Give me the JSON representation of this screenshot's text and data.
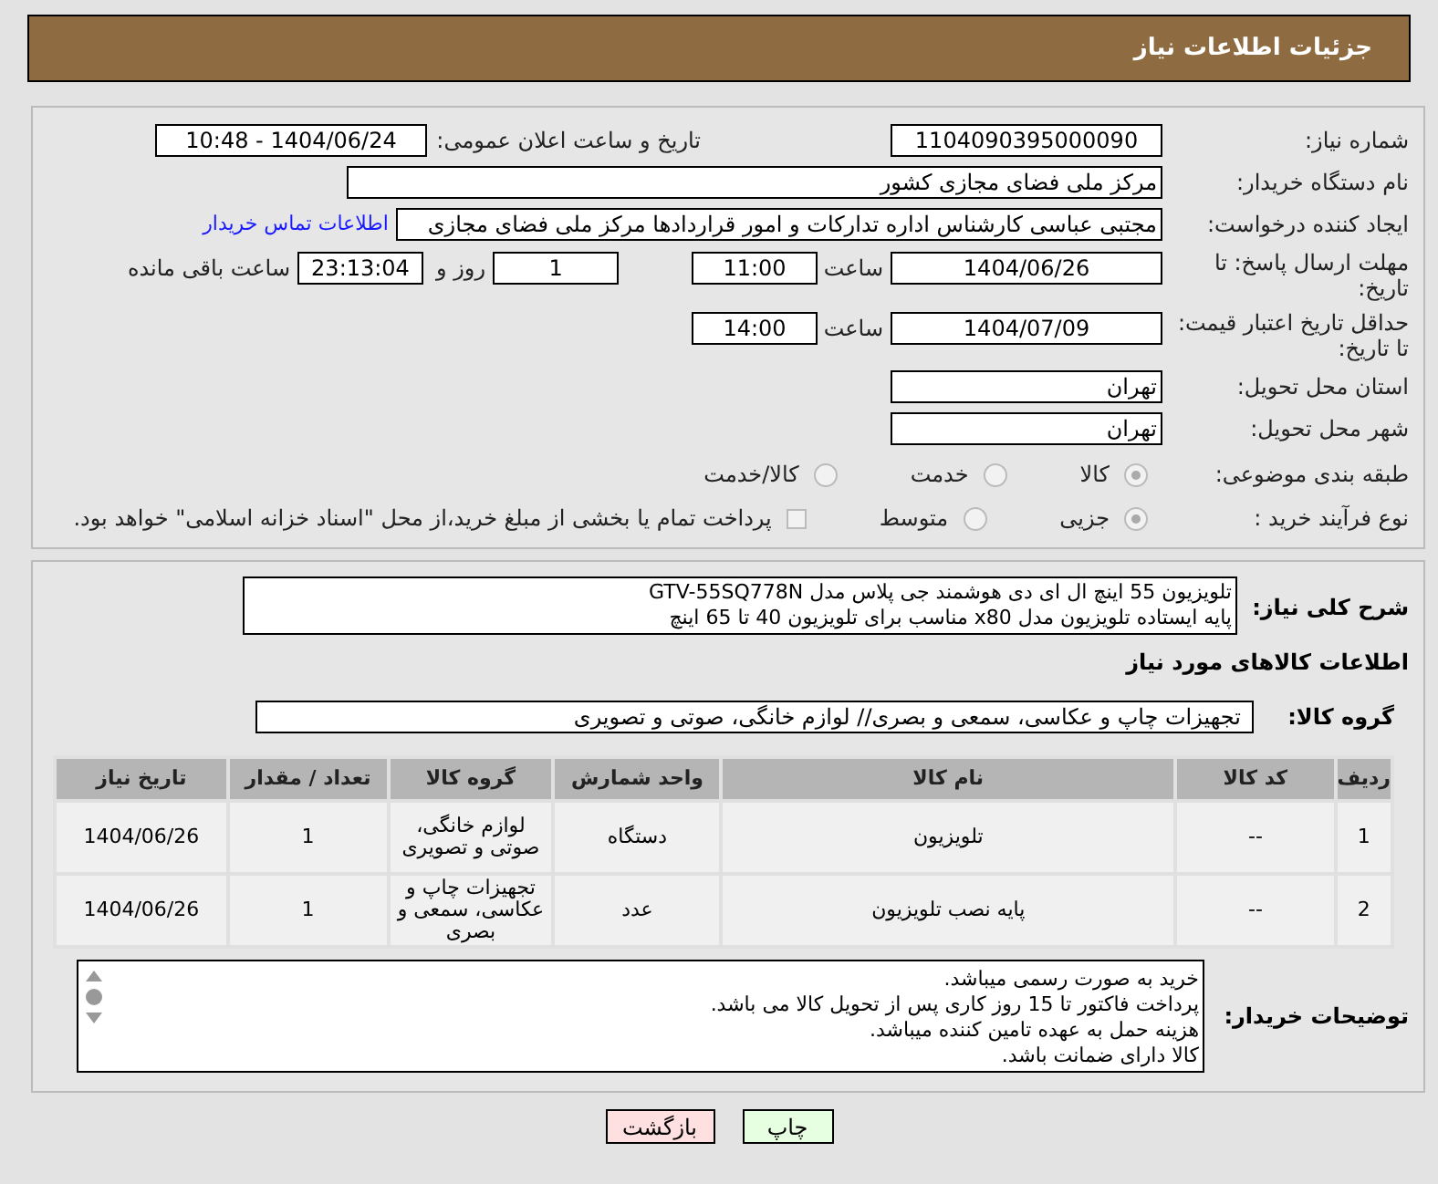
{
  "header": {
    "title": "جزئیات اطلاعات نیاز"
  },
  "need_number": {
    "label": "شماره نیاز:",
    "value": "1104090395000090"
  },
  "announce": {
    "label": "تاریخ و ساعت اعلان عمومی:",
    "value": "1404/06/24 - 10:48"
  },
  "buyer": {
    "label": "نام دستگاه خریدار:",
    "value": "مرکز ملی فضای مجازی کشور"
  },
  "creator": {
    "label": "ایجاد کننده درخواست:",
    "value": "مجتبی عباسی کارشناس اداره تدارکات و امور قراردادها مرکز ملی فضای مجازی",
    "link": "اطلاعات تماس خریدار"
  },
  "deadline": {
    "label": "مهلت ارسال پاسخ: تا تاریخ:",
    "date": "1404/06/26",
    "time_label": "ساعت",
    "time": "11:00",
    "days": "1",
    "days_label": "روز و",
    "remaining": "23:13:04",
    "remaining_label": "ساعت باقی مانده"
  },
  "validity": {
    "label": "حداقل تاریخ اعتبار قیمت: تا تاریخ:",
    "date": "1404/07/09",
    "time_label": "ساعت",
    "time": "14:00"
  },
  "province": {
    "label": "استان محل تحویل:",
    "value": "تهران"
  },
  "city": {
    "label": "شهر محل تحویل:",
    "value": "تهران"
  },
  "category": {
    "label": "طبقه بندی موضوعی:",
    "options": [
      {
        "label": "کالا",
        "selected": true
      },
      {
        "label": "خدمت",
        "selected": false
      },
      {
        "label": "کالا/خدمت",
        "selected": false
      }
    ]
  },
  "process": {
    "label": "نوع فرآیند خرید :",
    "options": [
      {
        "label": "جزیی",
        "selected": true
      },
      {
        "label": "متوسط",
        "selected": false
      }
    ],
    "payment": {
      "label": "پرداخت تمام یا بخشی از مبلغ خرید،از محل \"اسناد خزانه اسلامی\" خواهد بود.",
      "checked": false
    }
  },
  "description": {
    "label": "شرح کلی نیاز:",
    "lines": [
      "تلویزیون 55 اینچ ال ای دی هوشمند جی پلاس مدل GTV-55SQ778N",
      "پایه ایستاده تلویزیون مدل x80 مناسب برای تلویزیون 40 تا 65 اینچ"
    ]
  },
  "goods_title": "اطلاعات کالاهای مورد نیاز",
  "goods_group": {
    "label": "گروه کالا:",
    "value": "تجهیزات چاپ و عکاسی، سمعی و بصری// لوازم خانگی، صوتی و تصویری"
  },
  "table": {
    "columns": [
      "ردیف",
      "کد کالا",
      "نام کالا",
      "واحد شمارش",
      "گروه کالا",
      "تعداد / مقدار",
      "تاریخ نیاز"
    ],
    "rows": [
      [
        "1",
        "--",
        "تلویزیون",
        "دستگاه",
        "لوازم خانگی، صوتی و تصویری",
        "1",
        "1404/06/26"
      ],
      [
        "2",
        "--",
        "پایه نصب تلویزیون",
        "عدد",
        "تجهیزات چاپ و عکاسی، سمعی و بصری",
        "1",
        "1404/06/26"
      ]
    ]
  },
  "notes": {
    "label": "توضیحات خریدار:",
    "lines": [
      "خرید به صورت رسمی میباشد.",
      "پرداخت فاکتور تا 15 روز کاری پس از تحویل کالا می باشد.",
      "هزینه حمل به عهده تامین کننده میباشد.",
      "کالا دارای ضمانت باشد."
    ]
  },
  "buttons": [
    {
      "label": "چاپ",
      "kind": "print"
    },
    {
      "label": "بازگشت",
      "kind": "back"
    }
  ]
}
